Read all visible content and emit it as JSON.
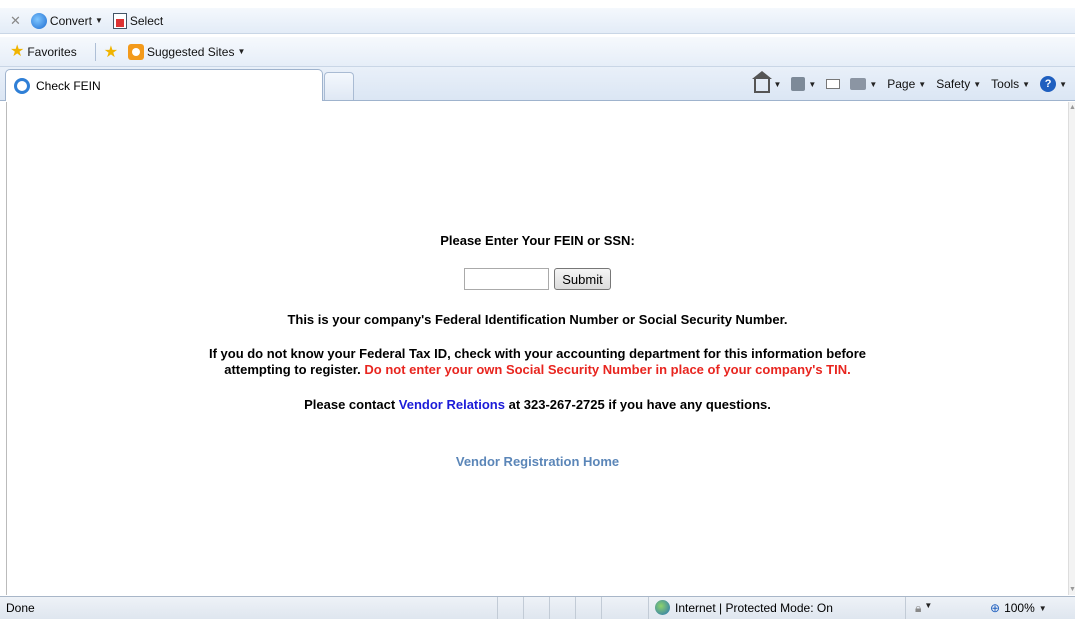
{
  "toolbar": {
    "convert_label": "Convert",
    "select_label": "Select"
  },
  "favorites_bar": {
    "favorites_label": "Favorites",
    "suggested_label": "Suggested Sites"
  },
  "tab": {
    "title": "Check FEIN"
  },
  "command_bar": {
    "page_label": "Page",
    "safety_label": "Safety",
    "tools_label": "Tools"
  },
  "content": {
    "prompt": "Please Enter Your FEIN or SSN:",
    "input_value": "",
    "submit_label": "Submit",
    "info_line": "This is your company's Federal Identification Number or Social Security Number.",
    "info_line2_a": "If you do not know your Federal Tax ID, check with your accounting department for this information before",
    "info_line2_b": "attempting to register.",
    "warning": "Do not enter your own Social Security Number in place of your company's TIN.",
    "contact_prefix": "Please contact",
    "contact_link": "Vendor Relations",
    "contact_suffix": "at 323-267-2725 if you have any questions.",
    "home_link": "Vendor Registration Home"
  },
  "status_bar": {
    "status": "Done",
    "zone": "Internet | Protected Mode: On",
    "zoom": "100%"
  },
  "colors": {
    "warning_red": "#e8251f",
    "link_blue": "#1b1bd8",
    "home_link": "#5b86b8"
  }
}
